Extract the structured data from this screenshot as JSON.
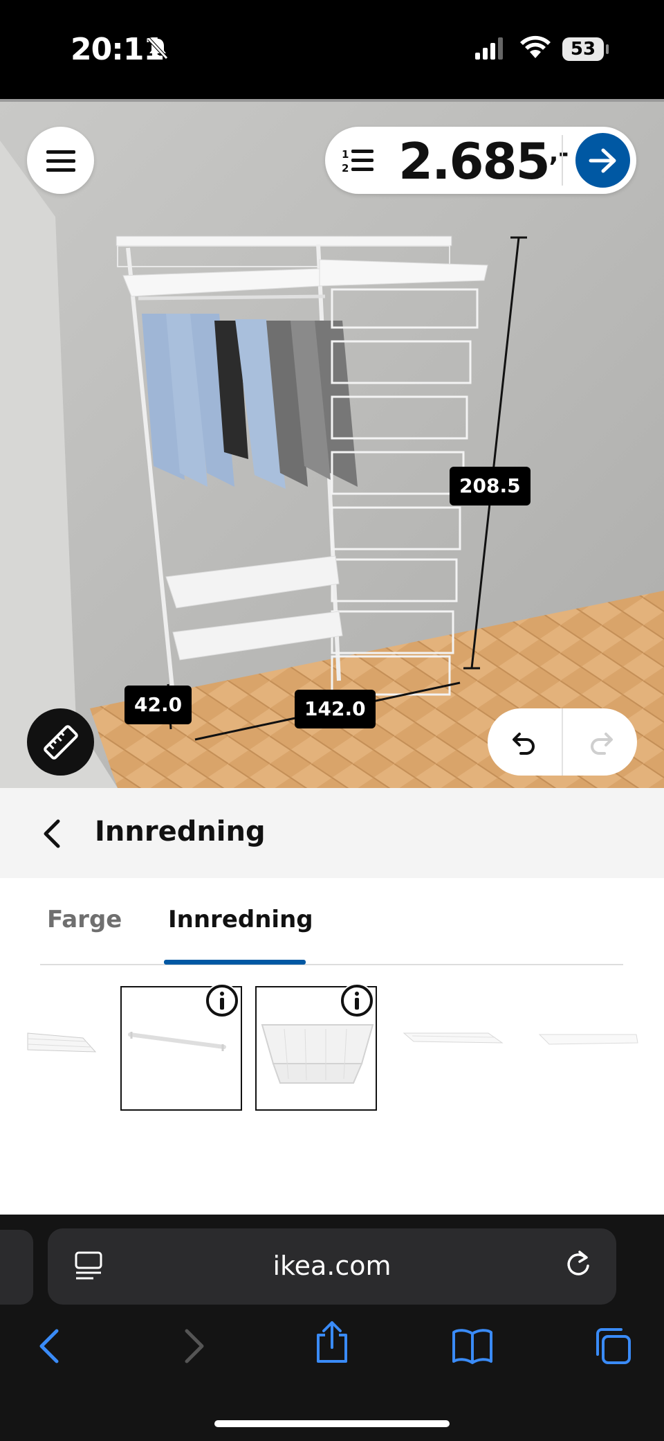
{
  "status_bar": {
    "time": "20:11",
    "battery": "53"
  },
  "configurator": {
    "price": "2.685",
    "price_suffix": ",-",
    "dimensions": {
      "height": "208.5",
      "width": "142.0",
      "depth": "42.0"
    }
  },
  "panel": {
    "title": "Innredning",
    "tabs": [
      {
        "label": "Farge",
        "active": false
      },
      {
        "label": "Innredning",
        "active": true
      }
    ]
  },
  "browser": {
    "url": "ikea.com"
  },
  "colors": {
    "accent": "#0058a3",
    "floor": "#d9a46a",
    "wall": "#bdbdbb"
  }
}
